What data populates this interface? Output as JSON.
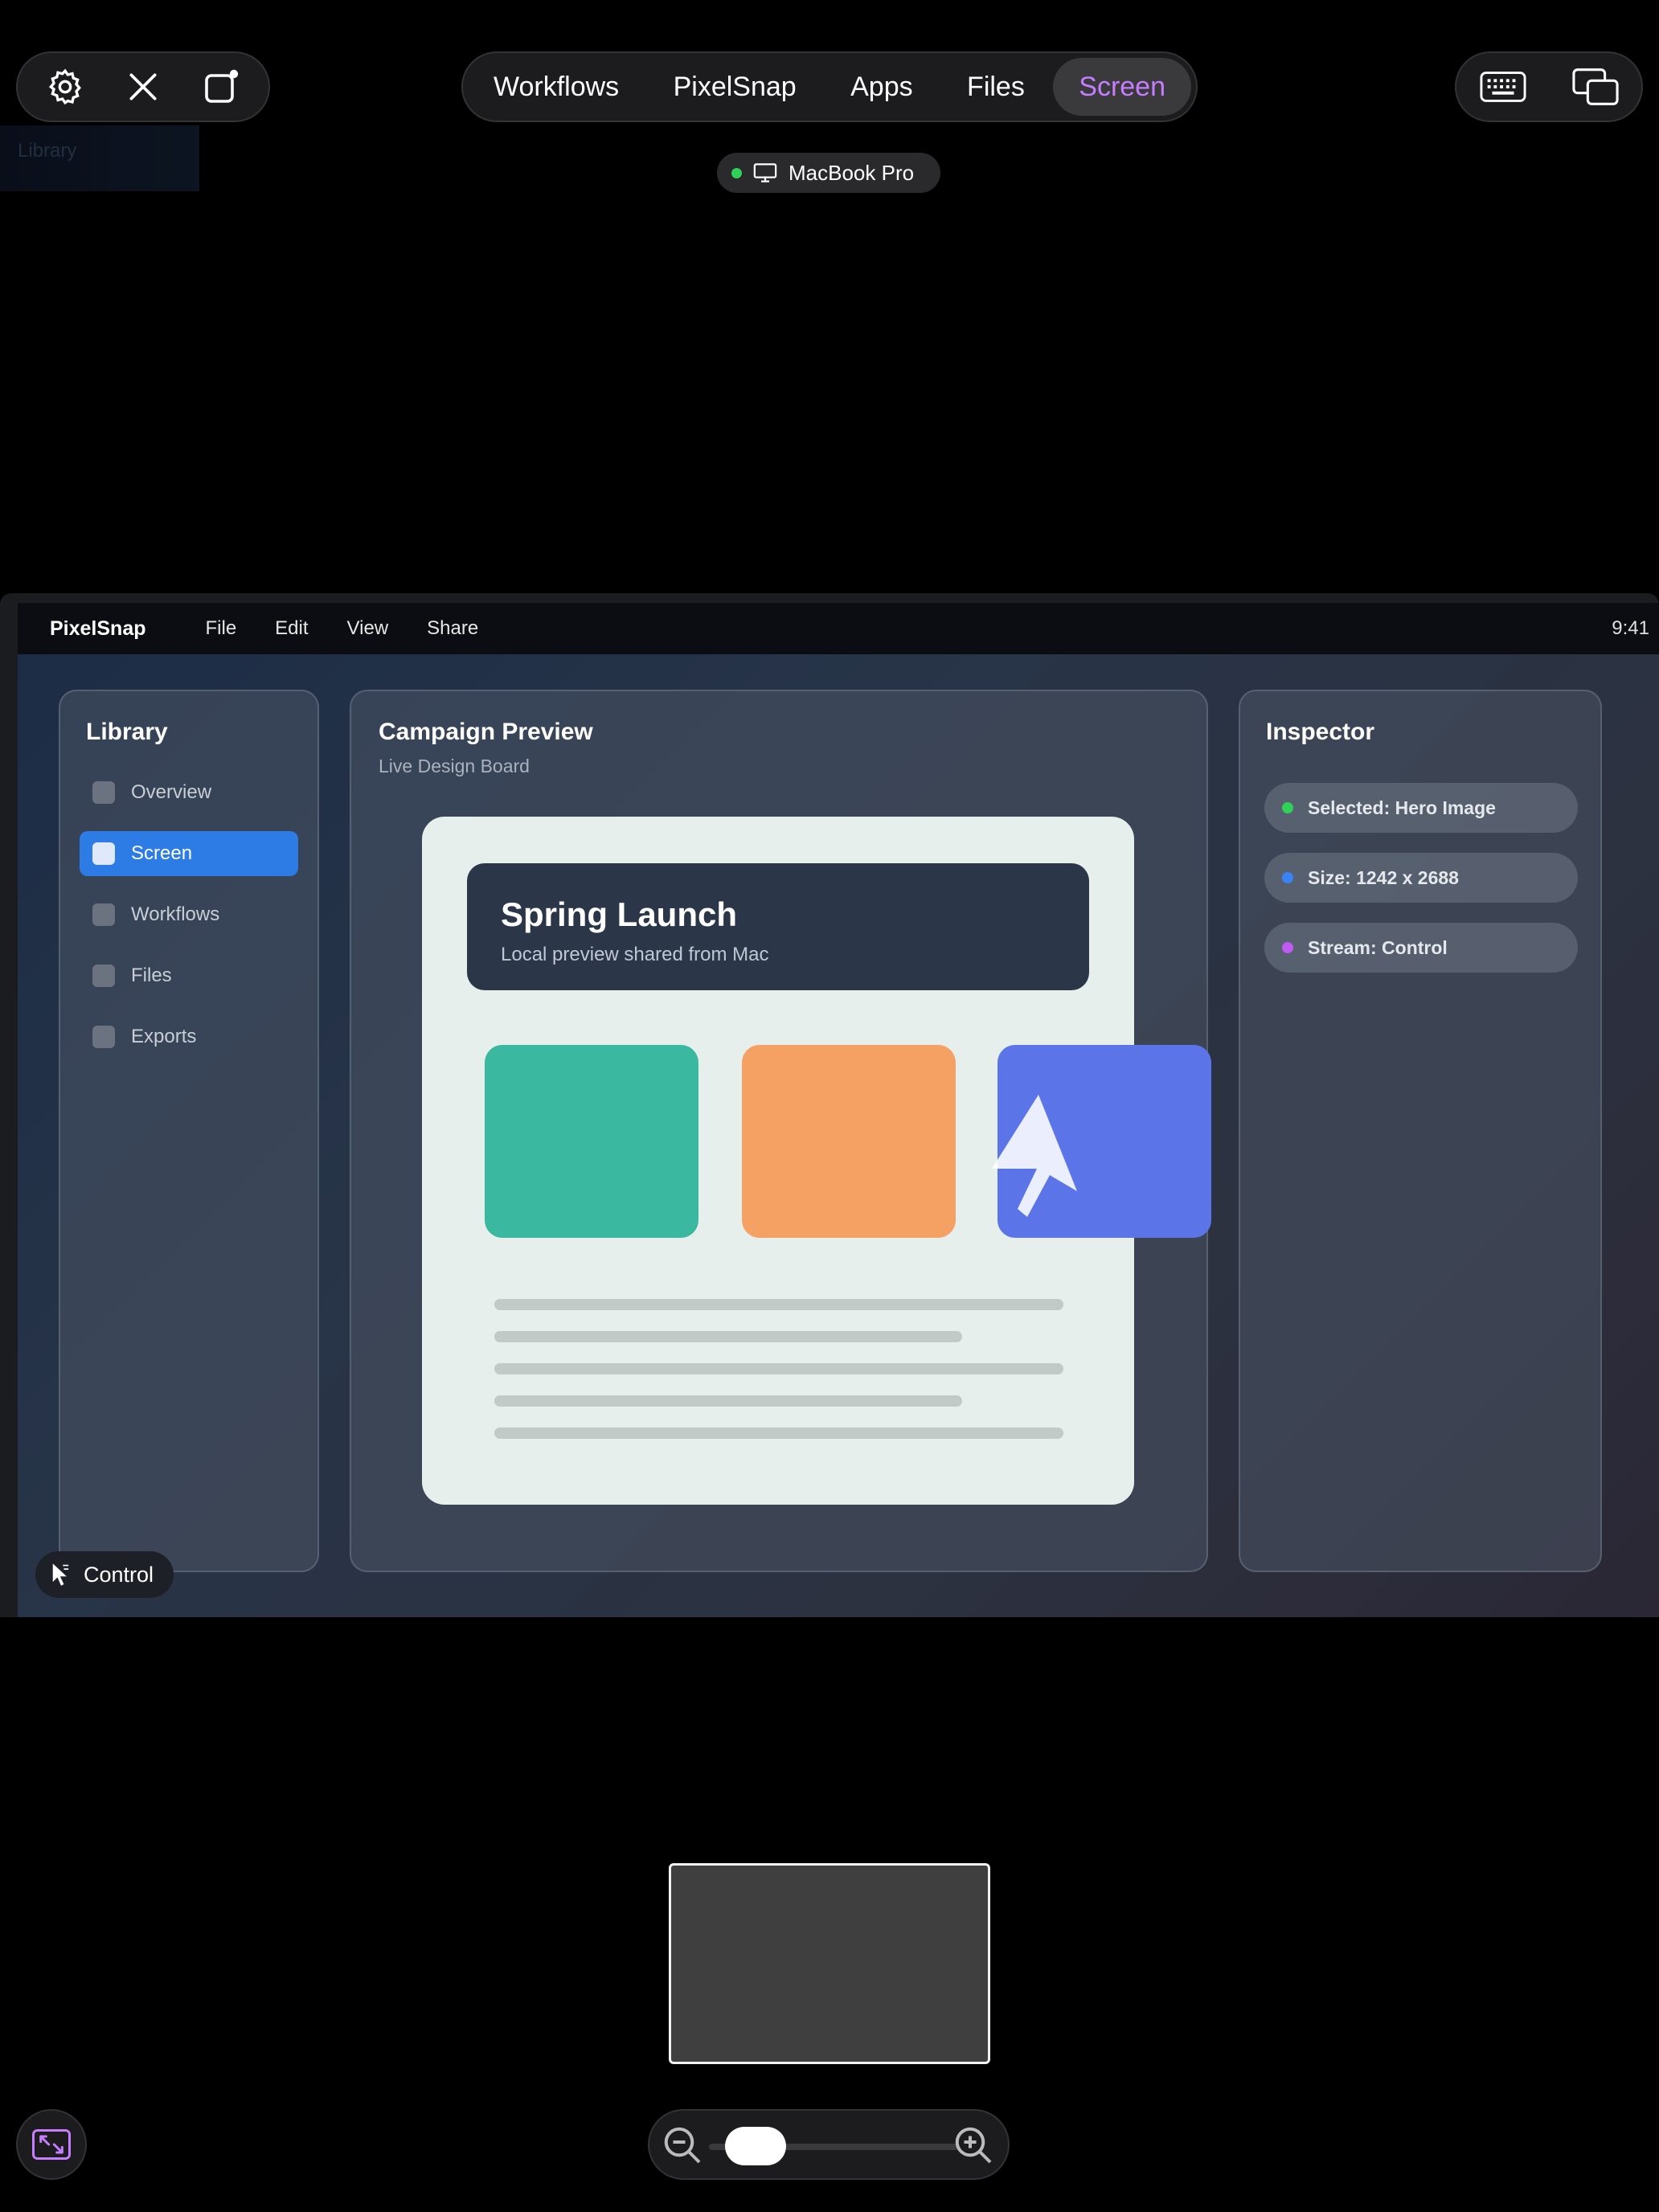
{
  "toolbar": {
    "settings_icon": "gear-icon",
    "close_icon": "close-icon",
    "rotate_icon": "rotate-screen-icon",
    "keyboard_icon": "keyboard-icon",
    "display_icon": "display-switch-icon"
  },
  "tabs": [
    {
      "label": "Workflows",
      "active": false
    },
    {
      "label": "PixelSnap",
      "active": false
    },
    {
      "label": "Apps",
      "active": false
    },
    {
      "label": "Files",
      "active": false
    },
    {
      "label": "Screen",
      "active": true
    }
  ],
  "device": {
    "name": "MacBook Pro",
    "status_color": "#30d158"
  },
  "ghost": {
    "label": "Library"
  },
  "mac": {
    "menubar": {
      "app": "PixelSnap",
      "items": [
        "File",
        "Edit",
        "View",
        "Share"
      ],
      "clock": "9:41"
    },
    "library": {
      "title": "Library",
      "items": [
        {
          "label": "Overview",
          "active": false
        },
        {
          "label": "Screen",
          "active": true
        },
        {
          "label": "Workflows",
          "active": false
        },
        {
          "label": "Files",
          "active": false
        },
        {
          "label": "Exports",
          "active": false
        }
      ]
    },
    "canvas": {
      "title": "Campaign Preview",
      "subtitle": "Live Design Board",
      "hero": {
        "title": "Spring Launch",
        "subtitle": "Local preview shared from Mac"
      },
      "tile_colors": [
        "#3bb8a0",
        "#f4a163",
        "#5b74e8"
      ]
    },
    "inspector": {
      "title": "Inspector",
      "chips": [
        {
          "label": "Selected: Hero Image",
          "color": "#30d158"
        },
        {
          "label": "Size: 1242 x 2688",
          "color": "#3a82f7"
        },
        {
          "label": "Stream: Control",
          "color": "#bf5af2"
        }
      ]
    }
  },
  "control_mode": {
    "label": "Control",
    "icon": "pointer-icon"
  },
  "zoom": {
    "level": 0.12,
    "out_icon": "zoom-out-icon",
    "in_icon": "zoom-in-icon"
  },
  "accent": "#c77dff"
}
